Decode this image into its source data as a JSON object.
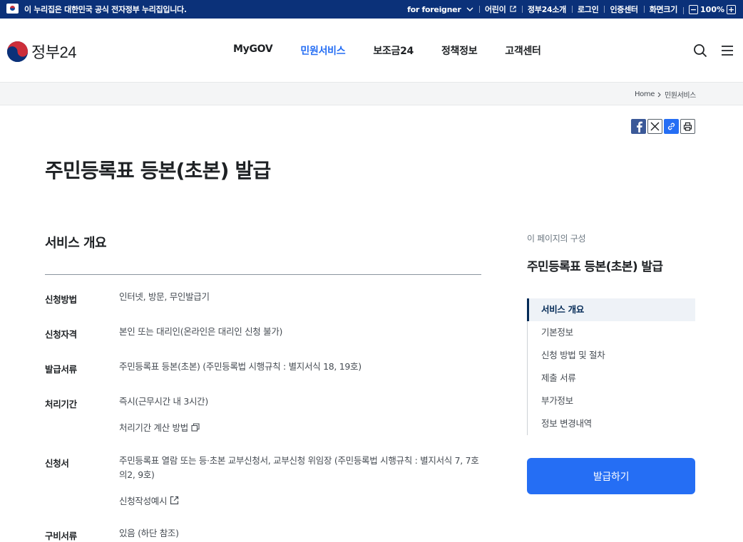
{
  "gov_banner": {
    "notice": "이 누리집은 대한민국 공식 전자정부 누리집입니다."
  },
  "util_nav": {
    "foreigner": "for foreigner",
    "kids": "어린이",
    "about": "정부24소개",
    "login": "로그인",
    "cert": "인증센터",
    "screen_size": "화면크기",
    "zoom_level": "100%"
  },
  "header": {
    "logo_text": "정부24",
    "nav": [
      {
        "label": "MyGOV"
      },
      {
        "label": "민원서비스",
        "active": true
      },
      {
        "label": "보조금24"
      },
      {
        "label": "정책정보"
      },
      {
        "label": "고객센터"
      }
    ]
  },
  "breadcrumb": {
    "home": "Home",
    "current": "민원서비스"
  },
  "page": {
    "title": "주민등록표 등본(초본) 발급"
  },
  "overview": {
    "section_title": "서비스 개요",
    "rows": [
      {
        "label": "신청방법",
        "value": "인터넷, 방문, 무인발급기"
      },
      {
        "label": "신청자격",
        "value": "본인 또는 대리인(온라인은 대리인 신청 불가)"
      },
      {
        "label": "발급서류",
        "value": "주민등록표 등본(초본) (주민등록법 시행규칙 : 별지서식 18, 19호)"
      },
      {
        "label": "처리기간",
        "value": "즉시(근무시간 내 3시간)",
        "link": "처리기간 계산 방법"
      },
      {
        "label": "신청서",
        "value": "주민등록표 열람 또는 등·초본 교부신청서, 교부신청 위임장 (주민등록법 시행규칙 : 별지서식 7, 7호의2, 9호)",
        "link": "신청작성예시"
      },
      {
        "label": "구비서류",
        "value": "있음 (하단 참조)"
      }
    ]
  },
  "aside": {
    "caption": "이 페이지의 구성",
    "title": "주민등록표 등본(초본) 발급",
    "toc": [
      {
        "label": "서비스 개요",
        "active": true
      },
      {
        "label": "기본정보"
      },
      {
        "label": "신청 방법 및 절차"
      },
      {
        "label": "제출 서류"
      },
      {
        "label": "부가정보"
      },
      {
        "label": "정보 변경내역"
      }
    ],
    "issue_button": "발급하기"
  },
  "colors": {
    "banner_bg": "#0b3179",
    "accent": "#256ef4",
    "active_toc": "#052b57"
  }
}
